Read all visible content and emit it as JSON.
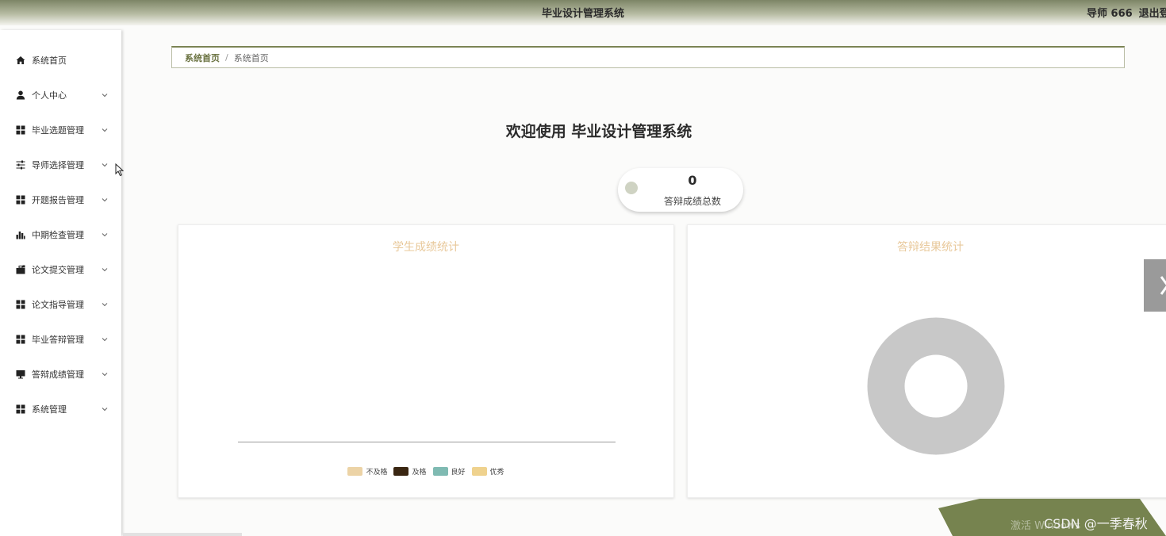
{
  "header": {
    "title": "毕业设计管理系统",
    "user_label": "导师 666",
    "logout_label": "退出登录"
  },
  "sidebar": {
    "items": [
      {
        "label": "系统首页",
        "icon": "home-icon"
      },
      {
        "label": "个人中心",
        "icon": "user-icon"
      },
      {
        "label": "毕业选题管理",
        "icon": "grid-icon"
      },
      {
        "label": "导师选择管理",
        "icon": "sliders-icon"
      },
      {
        "label": "开题报告管理",
        "icon": "grid-icon"
      },
      {
        "label": "中期检查管理",
        "icon": "bar-chart-icon"
      },
      {
        "label": "论文提交管理",
        "icon": "briefcase-icon"
      },
      {
        "label": "论文指导管理",
        "icon": "grid-icon"
      },
      {
        "label": "毕业答辩管理",
        "icon": "grid-icon"
      },
      {
        "label": "答辩成绩管理",
        "icon": "monitor-icon"
      },
      {
        "label": "系统管理",
        "icon": "grid-icon"
      }
    ]
  },
  "breadcrumb": {
    "home": "系统首页",
    "separator": "/",
    "current": "系统首页"
  },
  "main": {
    "welcome": "欢迎使用 毕业设计管理系统",
    "stat": {
      "value": "0",
      "label": "答辩成绩总数"
    }
  },
  "chart_data": [
    {
      "type": "bar",
      "title": "学生成绩统计",
      "categories": [],
      "series": [
        {
          "name": "不及格",
          "values": [],
          "color": "#ecd3a6"
        },
        {
          "name": "及格",
          "values": [],
          "color": "#3a2612"
        },
        {
          "name": "良好",
          "values": [],
          "color": "#7fbab2"
        },
        {
          "name": "优秀",
          "values": [],
          "color": "#efd28e"
        }
      ]
    },
    {
      "type": "pie",
      "title": "答辩结果统计",
      "slices": [],
      "empty_ring_color": "#c8c8c8"
    }
  ],
  "watermark": {
    "text": "CSDN @一季春秋",
    "faint_text": "激活 Windows"
  },
  "colors": {
    "accent": "#7b8354",
    "header_dark": "#7d8566",
    "chart_title": "#e8c89a",
    "corner_shape": "#76834f"
  }
}
